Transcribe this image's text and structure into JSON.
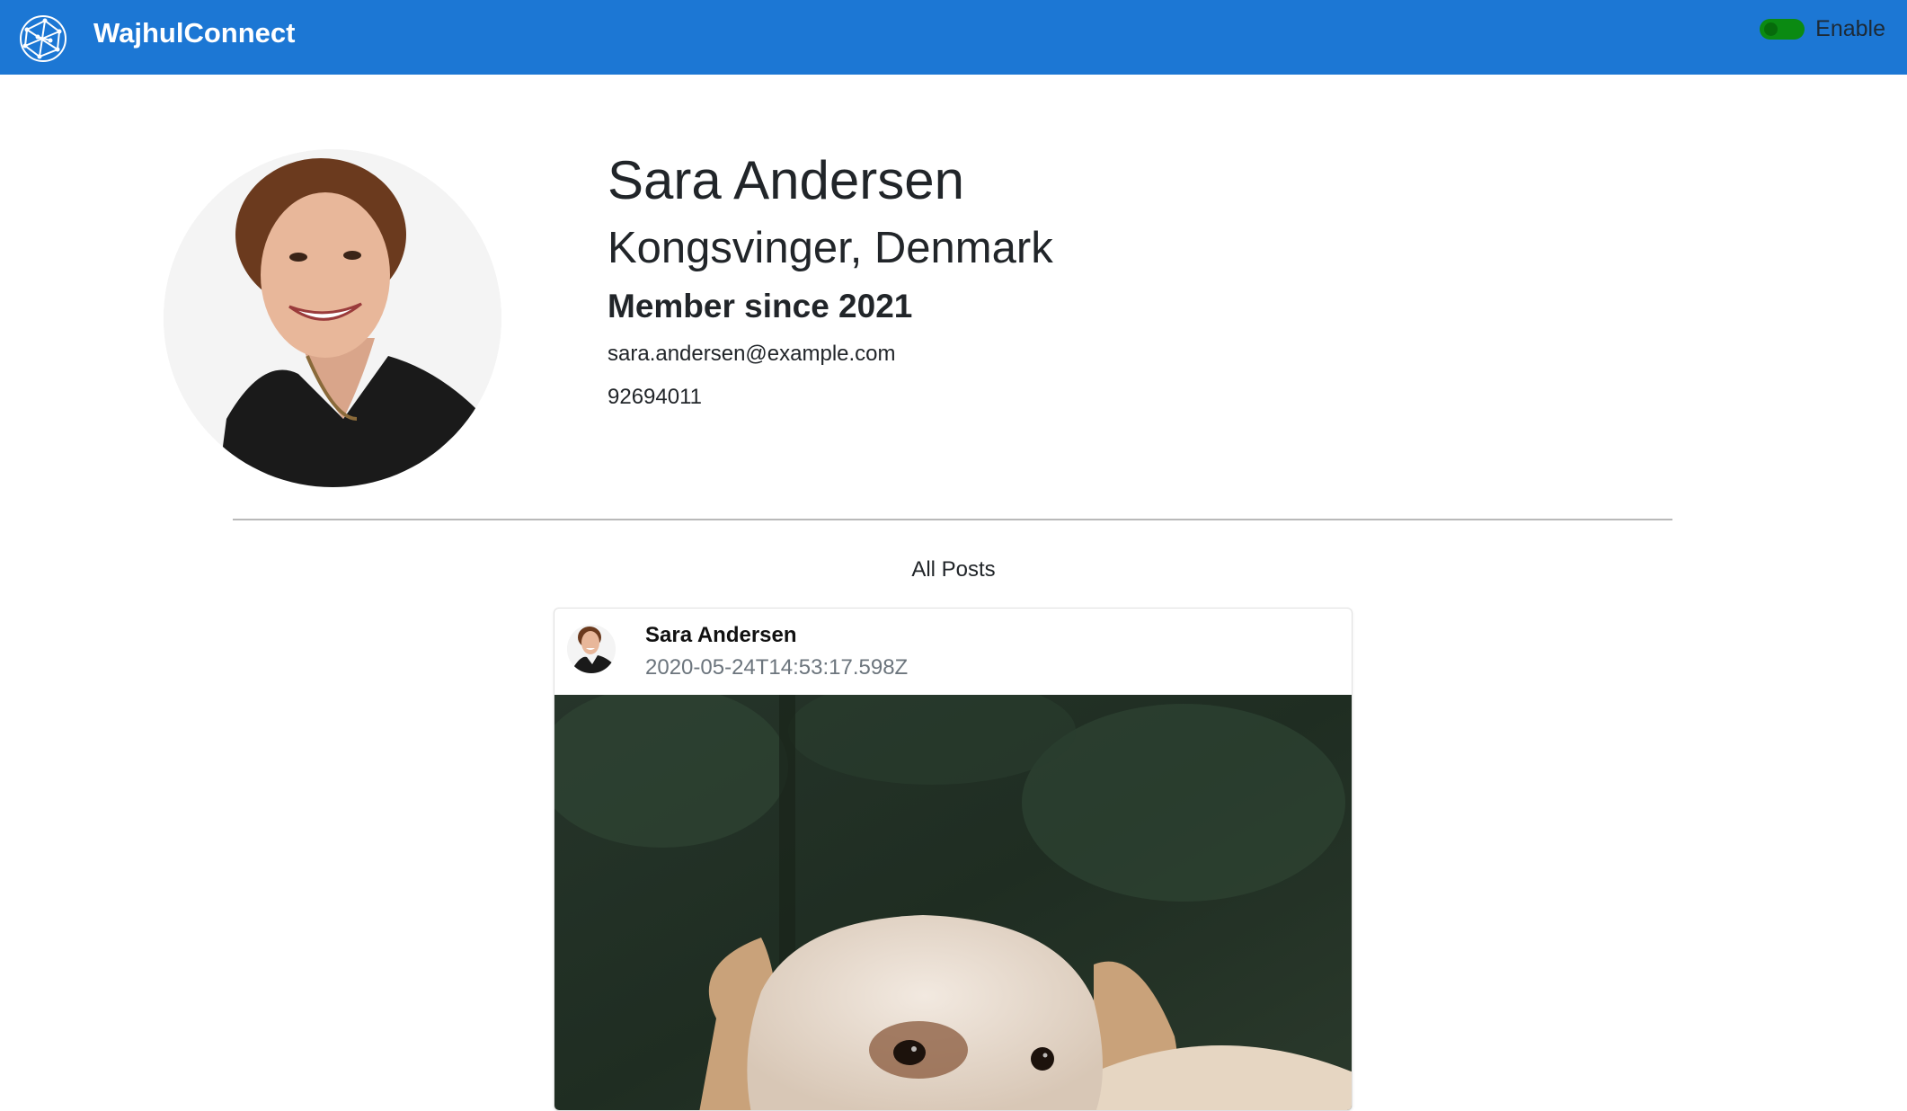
{
  "app": {
    "brand_name": "WajhulConnect",
    "brand_color": "#1c77d4",
    "logo_icon": "globe-network-icon"
  },
  "toggle": {
    "label": "Enable",
    "state": "on",
    "color": "#0b8a12"
  },
  "profile": {
    "name": "Sara Andersen",
    "location": "Kongsvinger, Denmark",
    "member_since": "Member since 2021",
    "email": "sara.andersen@example.com",
    "phone": "92694011"
  },
  "posts_section": {
    "title": "All Posts"
  },
  "posts": [
    {
      "author": "Sara Andersen",
      "timestamp": "2020-05-24T14:53:17.598Z"
    }
  ]
}
